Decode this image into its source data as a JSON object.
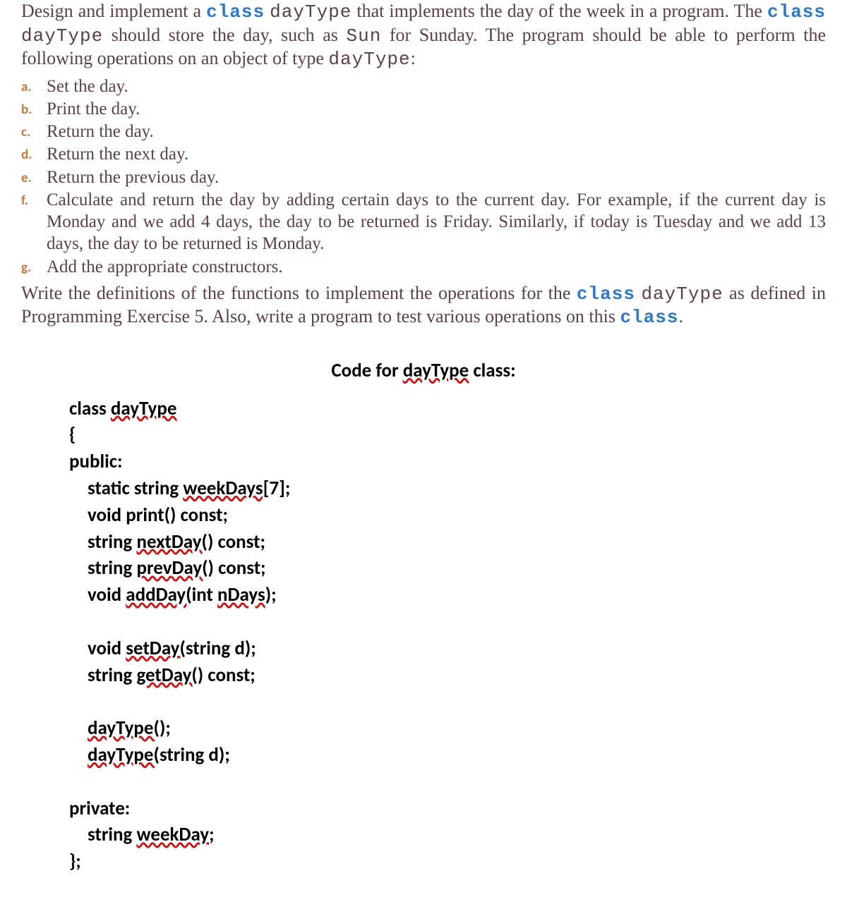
{
  "intro": {
    "t1": "Design and implement a ",
    "kw1": "class",
    "t2": " ",
    "m1": "dayType",
    "t3": " that implements the day of the week in a program. The ",
    "kw2": "class",
    "t4": " ",
    "m2": "dayType",
    "t5": " should store the day, such as ",
    "m3": "Sun",
    "t6": " for Sunday. The program should be able to perform the following operations on an object of type ",
    "m4": "dayType",
    "t7": ":"
  },
  "items": {
    "a": {
      "marker": "a.",
      "text": "Set the day."
    },
    "b": {
      "marker": "b.",
      "text": "Print the day."
    },
    "c": {
      "marker": "c.",
      "text": "Return the day."
    },
    "d": {
      "marker": "d.",
      "text": "Return the next day."
    },
    "e": {
      "marker": "e.",
      "text": "Return the previous day."
    },
    "f": {
      "marker": "f.",
      "text": "Calculate and return the day by adding certain days to the current day. For example, if the current day is Monday and we add 4 days, the day to be returned is Friday. Similarly, if today is Tuesday and we add 13 days, the day to be returned is Monday."
    },
    "g": {
      "marker": "g.",
      "text": "Add the appropriate constructors."
    }
  },
  "outro": {
    "t1": "Write the definitions of the functions to implement the operations for the ",
    "kw1": "class",
    "t2": " ",
    "m1": "dayType",
    "t3": " as defined in Programming Exercise 5. Also, write a program to test various operations on this ",
    "kw2": "class",
    "t4": "."
  },
  "code": {
    "title_pre": "Code for ",
    "title_sp": "dayType",
    "title_post": " class:",
    "l1_pre": "class ",
    "l1_sp": "dayType",
    "l2": "{",
    "l3": "public:",
    "l4_pre": "static string ",
    "l4_sp": "weekDays[",
    "l4_post": "7];",
    "l5": "void print() const;",
    "l6_pre": "string ",
    "l6_sp": "nextDay(",
    "l6_post": ") const;",
    "l7_pre": "string ",
    "l7_sp": "prevDay(",
    "l7_post": ") const;",
    "l8_pre": "void ",
    "l8_sp1": "addDay(",
    "l8_mid": "int ",
    "l8_sp2": "nDays",
    "l8_post": ");",
    "l9_pre": "void ",
    "l9_sp": "setDay(",
    "l9_post": "string d);",
    "l10_pre": "string ",
    "l10_sp": "getDay(",
    "l10_post": ") const;",
    "l11_sp": "dayType(",
    "l11_post": ");",
    "l12_sp": "dayType(",
    "l12_post": "string d);",
    "l13": "private:",
    "l14_pre": "string ",
    "l14_sp": "weekDay",
    "l14_post": ";",
    "l15": "};"
  }
}
